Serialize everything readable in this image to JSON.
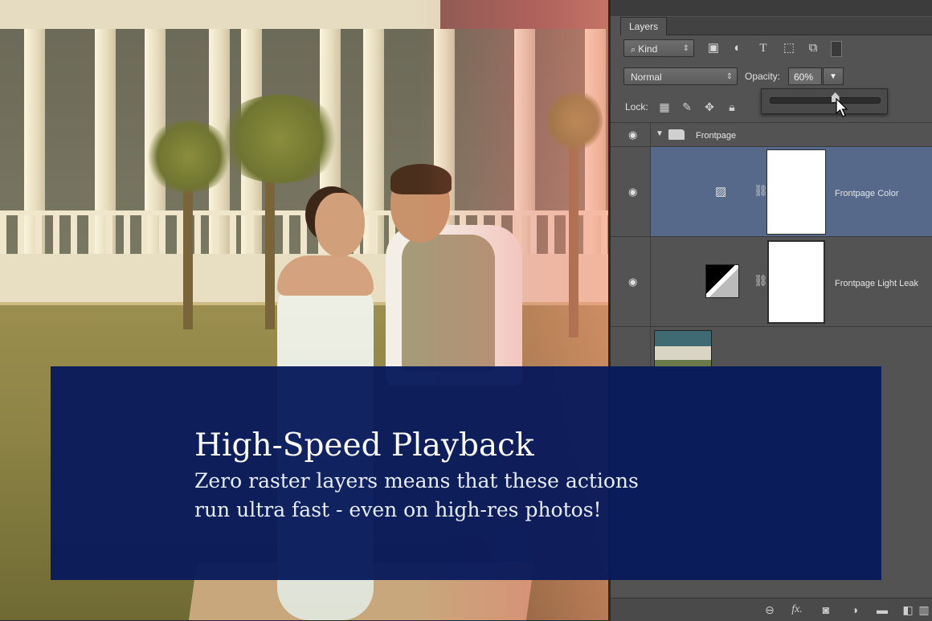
{
  "panel": {
    "tab_label": "Layers",
    "filter": {
      "label": "Kind",
      "icons": [
        "image-filter-icon",
        "adjustment-filter-icon",
        "type-filter-icon",
        "shape-filter-icon",
        "smart-object-filter-icon",
        "filter-toggle-icon"
      ]
    },
    "blend_mode": "Normal",
    "opacity_label": "Opacity:",
    "opacity_value": "60%",
    "opacity_fraction": 0.6,
    "lock_label": "Lock:",
    "lock_icons": [
      "lock-transparent-icon",
      "lock-image-icon",
      "lock-position-icon",
      "lock-all-icon"
    ]
  },
  "layers": {
    "group_name": "Frontpage",
    "color_layer": "Frontpage Color",
    "light_leak_layer": "Frontpage Light Leak"
  },
  "bottom_icons": [
    "link-layers-icon",
    "fx-icon",
    "add-mask-icon",
    "new-adjustment-icon",
    "new-group-icon",
    "new-layer-icon",
    "delete-layer-icon"
  ],
  "banner": {
    "title": "High-Speed Playback",
    "line1": "Zero raster layers means that these actions",
    "line2": "run ultra fast - even on high-res photos!"
  },
  "colors": {
    "banner_bg": "#081a5c",
    "selected_row": "#56698a",
    "panel_bg": "#535353"
  }
}
